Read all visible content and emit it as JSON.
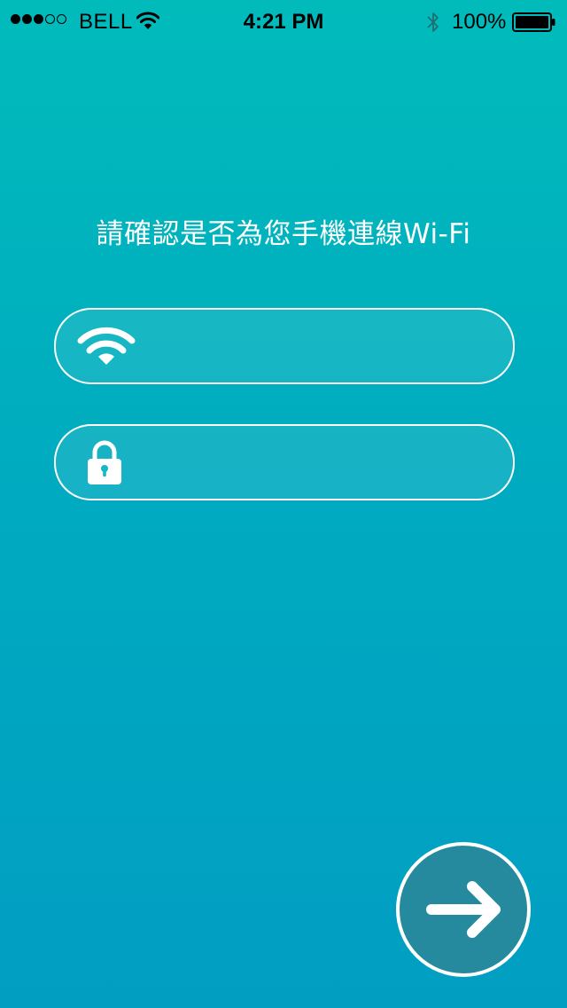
{
  "status_bar": {
    "signal_dots": [
      true,
      true,
      true,
      false,
      false
    ],
    "carrier": "BELL",
    "time": "4:21 PM",
    "battery_percent": "100%",
    "icons": [
      "wifi-icon",
      "bluetooth-icon",
      "battery-icon"
    ]
  },
  "main": {
    "prompt": "請確認是否為您手機連線Wi-Fi",
    "ssid_field": {
      "icon": "wifi-icon",
      "value": "",
      "placeholder": ""
    },
    "password_field": {
      "icon": "lock-icon",
      "value": "",
      "placeholder": ""
    },
    "next_button": {
      "icon": "arrow-right-icon"
    }
  },
  "colors": {
    "background_top": "#01BBBB",
    "background_bottom": "#019EC2",
    "button_fill": "#268A9E",
    "foreground": "#FFFFFF"
  }
}
